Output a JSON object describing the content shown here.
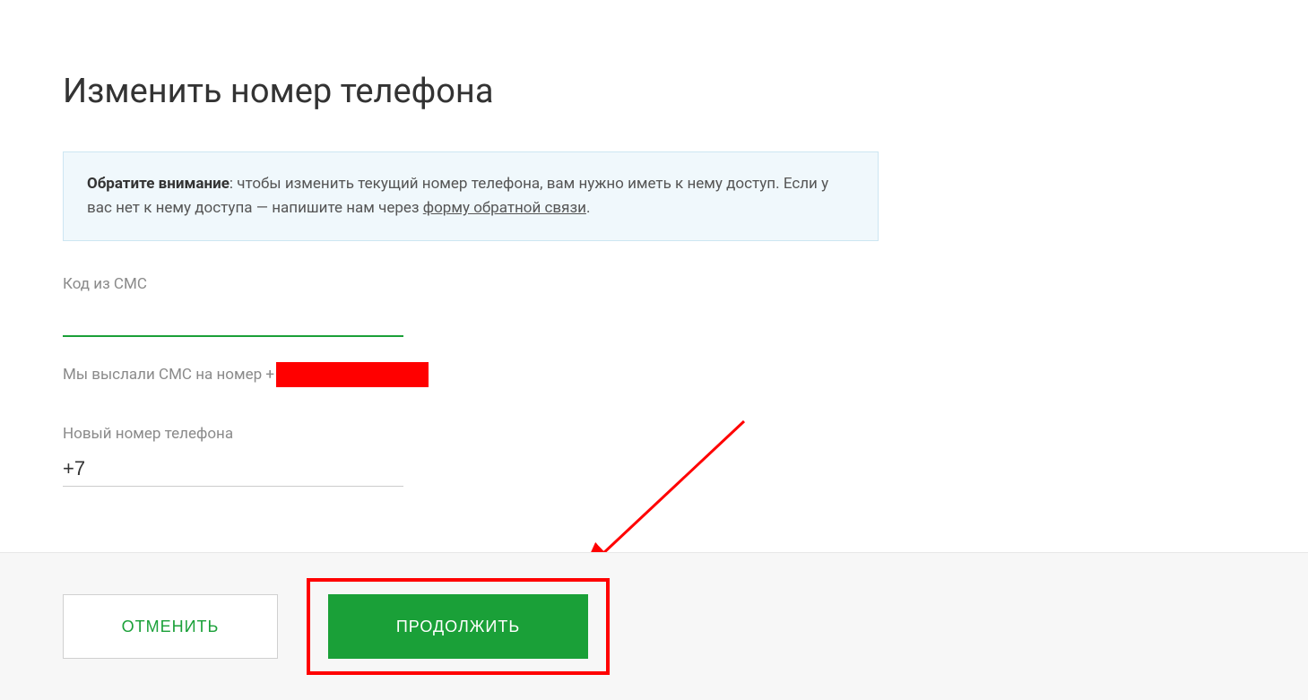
{
  "title": "Изменить номер телефона",
  "notice": {
    "bold": "Обратите внимание",
    "text_part1": ": чтобы изменить текущий номер телефона, вам нужно иметь к нему доступ. Если у вас нет к нему доступа — напишите нам через ",
    "link_text": "форму обратной связи",
    "text_part2": "."
  },
  "sms_code": {
    "label": "Код из СМС",
    "value": ""
  },
  "sms_sent": {
    "prefix": "Мы выслали СМС на номер +"
  },
  "new_phone": {
    "label": "Новый номер телефона",
    "value": "+7"
  },
  "buttons": {
    "cancel": "ОТМЕНИТЬ",
    "continue": "ПРОДОЛЖИТЬ"
  }
}
